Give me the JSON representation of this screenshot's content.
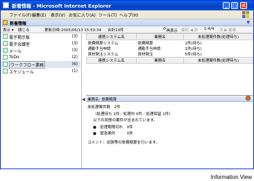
{
  "window": {
    "title": "新着情報 - Microsoft Internet Explorer"
  },
  "menu": [
    "ファイル(F)",
    "編集(E)",
    "表示(V)",
    "お気に入り(A)",
    "ツール(T)",
    "ヘルプ(H)"
  ],
  "pane": {
    "title": "新着情報"
  },
  "toolbar": {
    "view": "表示 ▾",
    "close": "閉じる",
    "updated": "更新日時:2005/06/13 15:53:34",
    "total": "合計19件",
    "refresh": "再表示",
    "nav_disabled_1": "最初 ◀ 前",
    "page": "1-4/4",
    "nav_disabled_2": "次 ▶ 最後"
  },
  "tree": [
    {
      "label": "電子掲示板",
      "count": "(3)",
      "icon": "bulletin-board-icon"
    },
    {
      "label": "電子会議室",
      "count": "(3)",
      "icon": "meeting-room-icon"
    },
    {
      "label": "メール",
      "count": "(3)",
      "icon": "mail-icon"
    },
    {
      "label": "ToDo",
      "count": "(2)",
      "icon": "todo-icon"
    },
    {
      "label": "ワークフロー業務",
      "count": "(6)",
      "icon": "workflow-icon",
      "selected": true
    },
    {
      "label": "スケジュール",
      "count": "(1)",
      "icon": "schedule-icon"
    }
  ],
  "table": {
    "headers": [
      "連携システム名",
      "業務名",
      "未処理案件数(処理待ち)"
    ],
    "rows": [
      [
        "旅費精算システム",
        "旅費精算",
        "2件(待ち)"
      ],
      [
        "通勤手当申請",
        "通勤手当申請",
        "1件(待ち)"
      ],
      [
        "資材発注システム",
        "資材発注",
        "5件(待ち)"
      ]
    ],
    "second_header": [
      "連携システム名",
      "業務名",
      "未処理案件数(処理待ち)"
    ]
  },
  "detail": {
    "header": "業務名: 旅費精算",
    "pending": "未処理案件数　2件",
    "breakdown": "（処理待ち 1件／処理中 0件／処理保留 1件）",
    "note": "以下の状態の案件が含まれています。",
    "bullet1": "●　処理期限切れ　0件",
    "bullet2": "●　緊急案件　　　0件",
    "comment": "コメント：出張等の旅費精算を行います。"
  },
  "caption": "Information View"
}
